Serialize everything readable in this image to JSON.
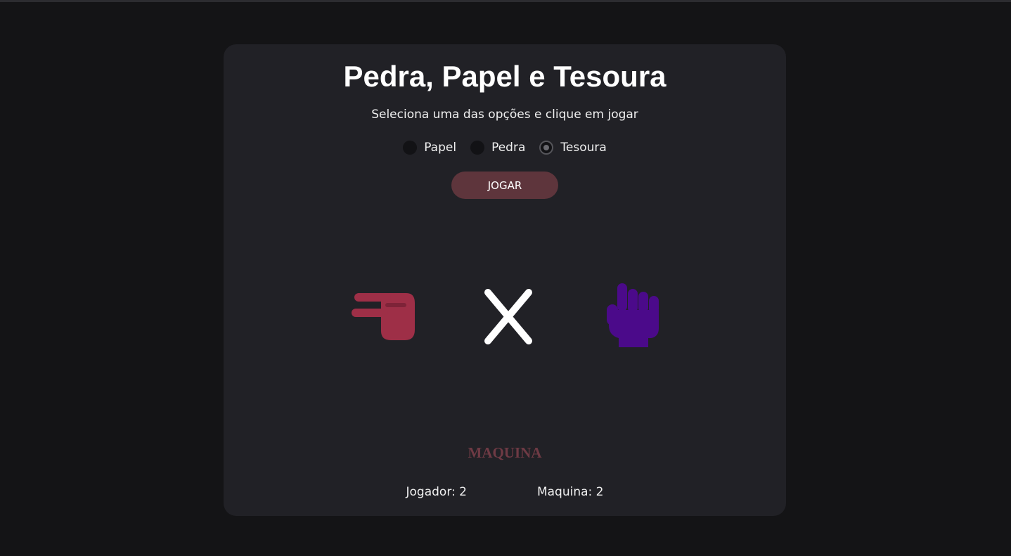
{
  "game": {
    "title": "Pedra, Papel e Tesoura",
    "subtitle": "Seleciona uma das opções e clique em jogar",
    "options": [
      {
        "label": "Papel",
        "selected": false
      },
      {
        "label": "Pedra",
        "selected": false
      },
      {
        "label": "Tesoura",
        "selected": true
      }
    ],
    "play_label": "JOGAR",
    "player_choice_icon": "scissors-hand-icon",
    "versus_icon": "x-icon",
    "machine_choice_icon": "rock-fist-icon",
    "result": "MAQUINA",
    "scores": {
      "player": "Jogador: 2",
      "machine": "Maquina: 2"
    }
  },
  "colors": {
    "page_background": "#141416",
    "card_background": "#212126",
    "button_background": "#5e353c",
    "player_hand": "#9e2f47",
    "machine_hand": "#4b0a8a",
    "result_text": "#6e3a44"
  }
}
